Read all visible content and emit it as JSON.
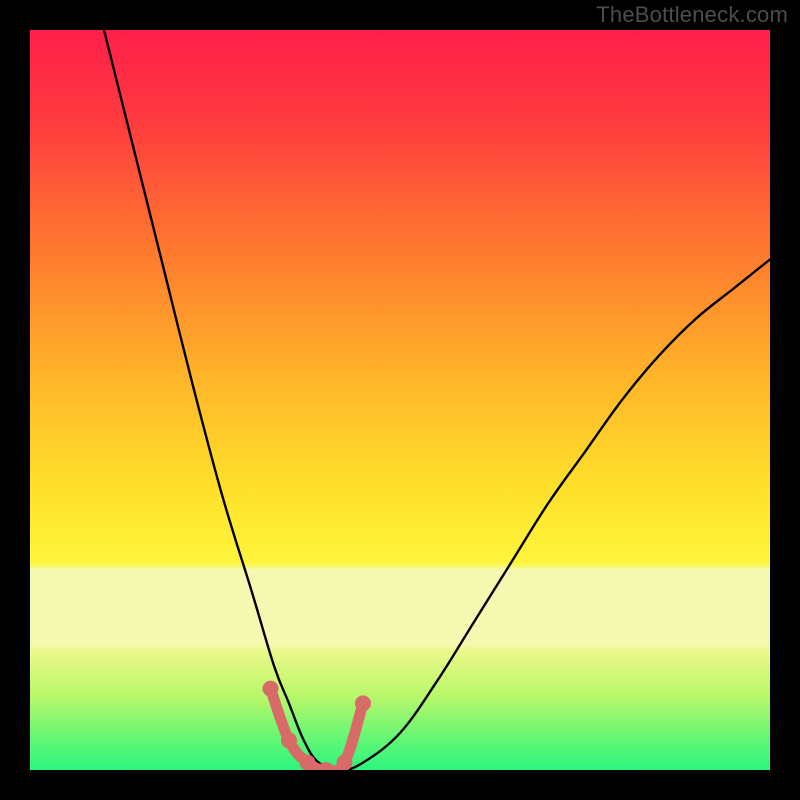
{
  "watermark": "TheBottleneck.com",
  "chart_data": {
    "type": "line",
    "title": "",
    "xlabel": "",
    "ylabel": "",
    "xlim": [
      0,
      100
    ],
    "ylim": [
      0,
      100
    ],
    "grid": false,
    "legend": false,
    "background_gradient": {
      "top_color": "#ff1f4b",
      "mid_color": "#ffe02a",
      "bottom_color": "#2cf57e",
      "band_color": "#f5f8b0",
      "band_y_range": [
        68,
        78
      ]
    },
    "series": [
      {
        "name": "bottleneck-curve",
        "stroke": "#000000",
        "stroke_width": 2.4,
        "x": [
          10,
          14,
          18,
          22,
          26,
          30,
          33,
          35,
          37,
          39,
          42,
          45,
          50,
          55,
          60,
          65,
          70,
          75,
          80,
          85,
          90,
          95,
          100
        ],
        "y": [
          100,
          84,
          68,
          52,
          37,
          24,
          14,
          9,
          4,
          1,
          0,
          1,
          5,
          12,
          20,
          28,
          36,
          43,
          50,
          56,
          61,
          65,
          69
        ]
      }
    ],
    "markers": {
      "name": "highlight-points",
      "color": "#d86a68",
      "stroke_width": 11,
      "dot_radius": 8,
      "x": [
        32.5,
        35,
        37.5,
        40,
        42.5,
        45
      ],
      "y": [
        11,
        4,
        1,
        0,
        1,
        9
      ]
    }
  }
}
